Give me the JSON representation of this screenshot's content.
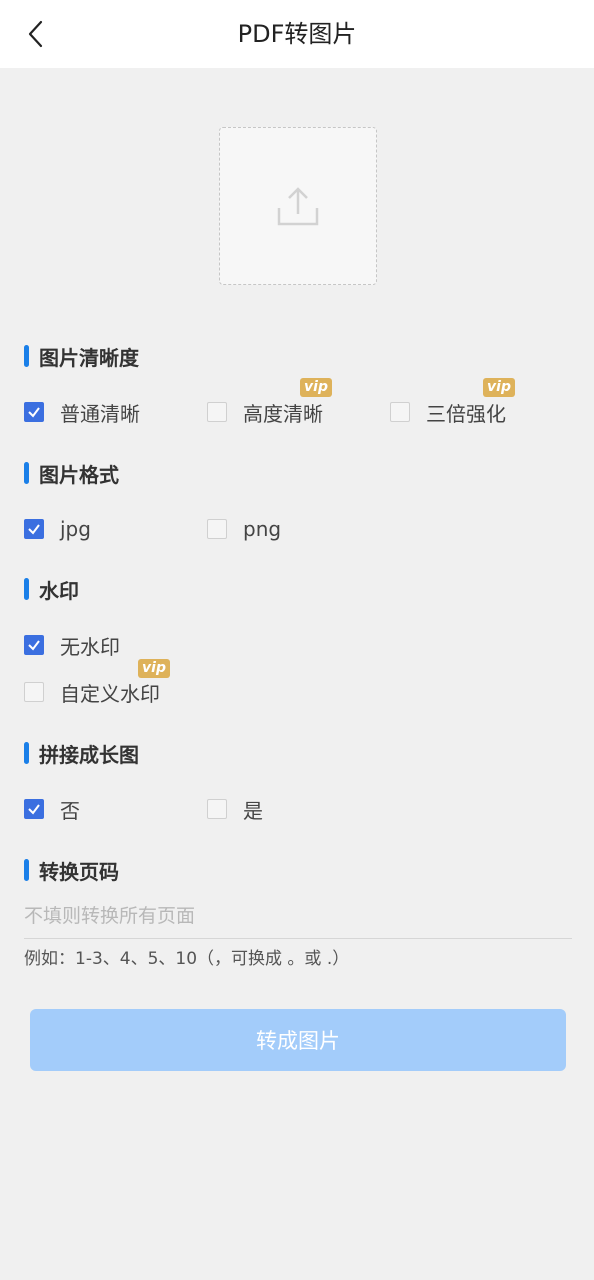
{
  "header": {
    "title": "PDF转图片"
  },
  "sections": {
    "clarity": {
      "title": "图片清晰度",
      "options": [
        {
          "label": "普通清晰",
          "checked": true,
          "vip": false
        },
        {
          "label": "高度清晰",
          "checked": false,
          "vip": true
        },
        {
          "label": "三倍强化",
          "checked": false,
          "vip": true
        }
      ]
    },
    "format": {
      "title": "图片格式",
      "options": [
        {
          "label": "jpg",
          "checked": true
        },
        {
          "label": "png",
          "checked": false
        }
      ]
    },
    "watermark": {
      "title": "水印",
      "options": [
        {
          "label": "无水印",
          "checked": true,
          "vip": false
        },
        {
          "label": "自定义水印",
          "checked": false,
          "vip": true
        }
      ]
    },
    "stitch": {
      "title": "拼接成长图",
      "options": [
        {
          "label": "否",
          "checked": true
        },
        {
          "label": "是",
          "checked": false
        }
      ]
    },
    "pages": {
      "title": "转换页码",
      "placeholder": "不填则转换所有页面",
      "value": "",
      "hint": "例如：1-3、4、5、10（，可换成 。或 .）"
    }
  },
  "vip_label": "vip",
  "convert_button": "转成图片",
  "colors": {
    "accent": "#1a7fe8",
    "checkbox_checked": "#3b6fe0",
    "vip_badge": "#deb25a",
    "button_disabled": "#a3ccfa"
  },
  "icons": {
    "back": "chevron-left-icon",
    "upload": "upload-icon",
    "check": "check-icon"
  }
}
